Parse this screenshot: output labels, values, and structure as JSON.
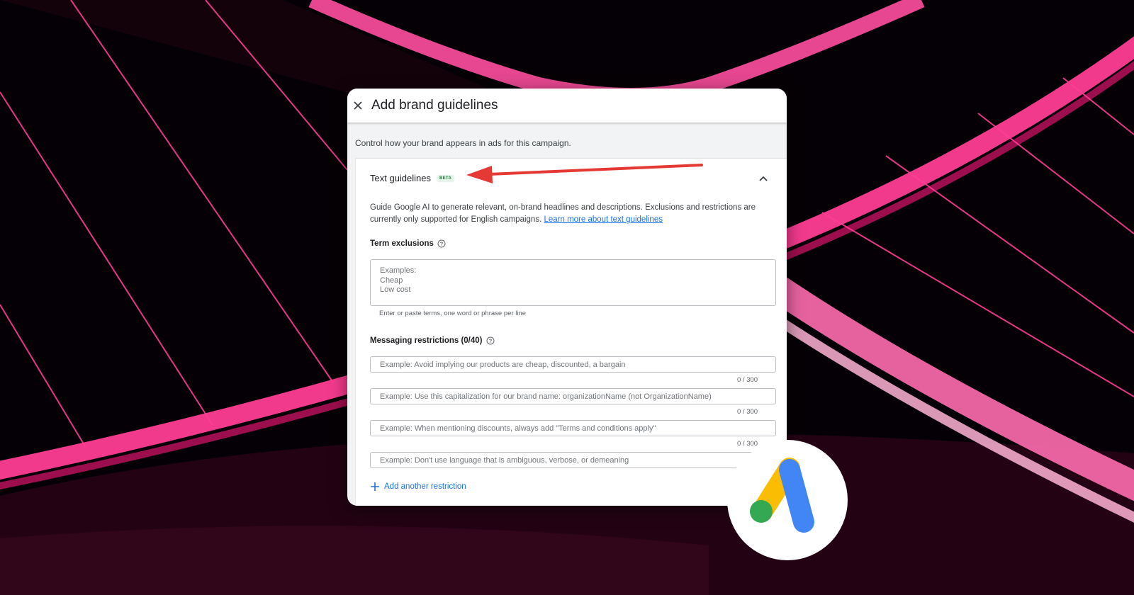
{
  "modal": {
    "title": "Add brand guidelines",
    "intro": "Control how your brand appears in ads for this campaign."
  },
  "text_guidelines": {
    "title": "Text guidelines",
    "badge": "BETA",
    "description": "Guide Google AI to generate relevant, on-brand headlines and descriptions. Exclusions and restrictions are currently only supported for English campaigns.",
    "learn_more_link": "Learn more about text guidelines"
  },
  "term_exclusions": {
    "label": "Term exclusions",
    "placeholder": "Examples:\nCheap\nLow cost",
    "hint": "Enter or paste terms, one word or phrase per line"
  },
  "messaging_restrictions": {
    "label": "Messaging restrictions (0/40)",
    "fields": [
      {
        "placeholder": "Example: Avoid implying our products are cheap, discounted, a bargain",
        "counter": "0 / 300"
      },
      {
        "placeholder": "Example: Use this capitalization for our brand name: organizationName (not OrganizationName)",
        "counter": "0 / 300"
      },
      {
        "placeholder": "Example: When mentioning discounts, always add \"Terms and conditions apply\"",
        "counter": "0 / 300"
      },
      {
        "placeholder": "Example: Don't use language that is ambiguous, verbose, or demeaning",
        "counter": ""
      }
    ],
    "add_button": "Add another restriction"
  },
  "icons": {
    "close": "close-icon",
    "collapse": "chevron-up-icon",
    "help": "help-circle-icon",
    "add": "plus-icon",
    "logo": "google-ads-logo"
  },
  "colors": {
    "accent": "#1a73e8",
    "arrow": "#e53935",
    "background_pink": "#ff2d8a",
    "logo_yellow": "#fbbc04",
    "logo_blue": "#4285f4",
    "logo_green": "#34a853"
  }
}
